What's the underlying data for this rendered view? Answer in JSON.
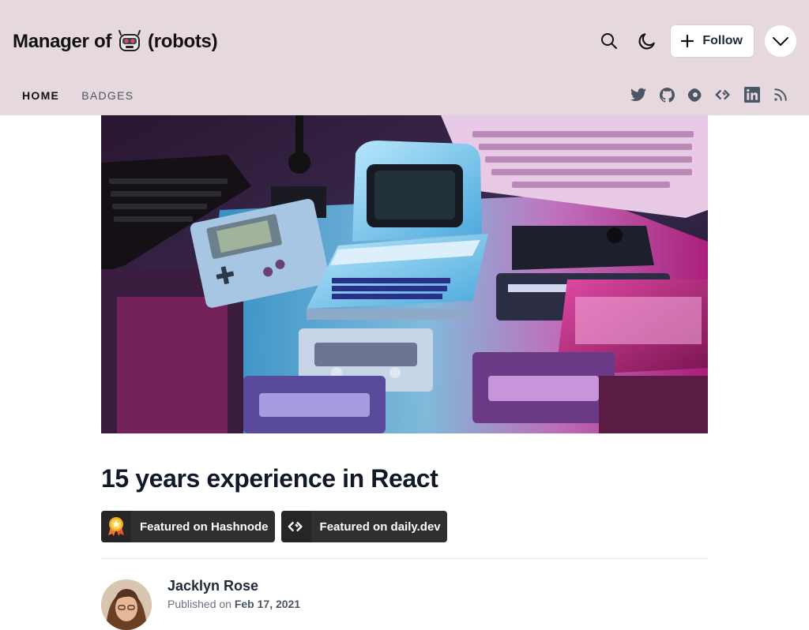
{
  "header": {
    "title_prefix": "Manager of",
    "title_suffix": "(robots)",
    "follow_label": "Follow",
    "icons": [
      "search-icon",
      "moon-icon",
      "plus-icon",
      "chevron-down-icon"
    ]
  },
  "nav": {
    "items": [
      {
        "label": "HOME",
        "active": true
      },
      {
        "label": "BADGES",
        "active": false
      }
    ]
  },
  "socials": [
    "twitter-icon",
    "github-icon",
    "hashnode-icon",
    "dailydev-icon",
    "linkedin-icon",
    "rss-icon"
  ],
  "post": {
    "title": "15 years experience in React",
    "badges": [
      {
        "label": "Featured on Hashnode",
        "icon": "featured-medal-icon"
      },
      {
        "label": "Featured on daily.dev",
        "icon": "dailydev-icon"
      }
    ],
    "author": "Jacklyn Rose",
    "published_prefix": "Published on",
    "published_date": "Feb 17, 2021"
  },
  "colors": {
    "header_bg": "#e5d9de",
    "badge_bg": "#2f2f2f",
    "text": "#111827"
  }
}
